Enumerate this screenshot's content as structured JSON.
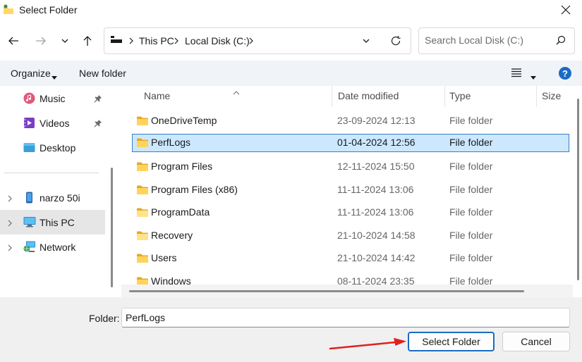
{
  "window": {
    "title": "Select Folder"
  },
  "address": {
    "crumbs": [
      "This PC",
      "Local Disk (C:)"
    ]
  },
  "search": {
    "placeholder": "Search Local Disk (C:)"
  },
  "commandbar": {
    "organize": "Organize",
    "new_folder": "New folder",
    "help": "?"
  },
  "sidebar": {
    "quick": [
      {
        "label": "Music",
        "icon": "music-icon",
        "pinned": true
      },
      {
        "label": "Videos",
        "icon": "videos-icon",
        "pinned": true
      },
      {
        "label": "Desktop",
        "icon": "desktop-icon",
        "pinned": false
      }
    ],
    "devices": [
      {
        "label": "narzo 50i",
        "icon": "phone-icon"
      },
      {
        "label": "This PC",
        "icon": "computer-icon",
        "selected": true
      },
      {
        "label": "Network",
        "icon": "network-icon"
      }
    ]
  },
  "filelist": {
    "columns": [
      "Name",
      "Date modified",
      "Type",
      "Size"
    ],
    "rows": [
      {
        "name": "OneDriveTemp",
        "date": "23-09-2024 12:13",
        "type": "File folder"
      },
      {
        "name": "PerfLogs",
        "date": "01-04-2024 12:56",
        "type": "File folder",
        "selected": true
      },
      {
        "name": "Program Files",
        "date": "12-11-2024 15:50",
        "type": "File folder"
      },
      {
        "name": "Program Files (x86)",
        "date": "11-11-2024 13:06",
        "type": "File folder"
      },
      {
        "name": "ProgramData",
        "date": "11-11-2024 13:06",
        "type": "File folder"
      },
      {
        "name": "Recovery",
        "date": "21-10-2024 14:58",
        "type": "File folder"
      },
      {
        "name": "Users",
        "date": "21-10-2024 14:42",
        "type": "File folder"
      },
      {
        "name": "Windows",
        "date": "08-11-2024 23:35",
        "type": "File folder"
      }
    ]
  },
  "footer": {
    "folder_label": "Folder:",
    "folder_value": "PerfLogs",
    "select_label": "Select Folder",
    "cancel_label": "Cancel"
  },
  "colors": {
    "accent": "#1a6bc4",
    "selection": "#cce8ff",
    "folder": "#f7c548",
    "arrow": "#e02020"
  }
}
